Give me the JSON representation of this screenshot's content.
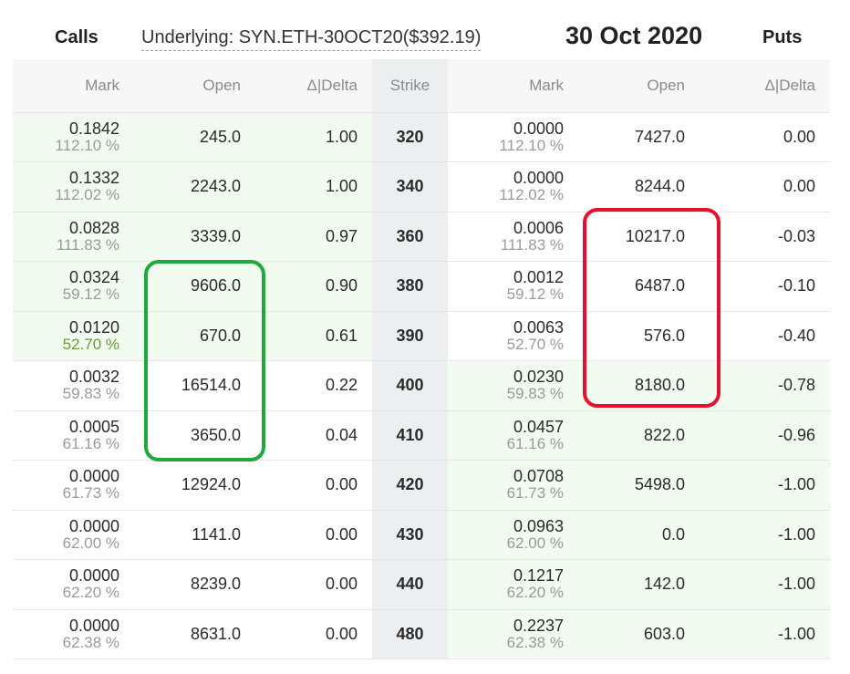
{
  "header": {
    "calls_label": "Calls",
    "underlying_label": "Underlying: SYN.ETH-30OCT20($392.19)",
    "date_label": "30 Oct 2020",
    "puts_label": "Puts"
  },
  "columns": {
    "call_mark": "Mark",
    "call_open": "Open",
    "call_delta": "Δ|Delta",
    "strike": "Strike",
    "put_mark": "Mark",
    "put_open": "Open",
    "put_delta": "Δ|Delta"
  },
  "colors": {
    "itm_background": "#f1fbf0",
    "green_highlight": "#1fa83b",
    "red_highlight": "#e4112f"
  },
  "rows": [
    {
      "call_mark": "0.1842",
      "call_iv": "112.10 %",
      "call_open": "245.0",
      "call_delta": "1.00",
      "strike": "320",
      "put_mark": "0.0000",
      "put_iv": "112.10 %",
      "put_open": "7427.0",
      "put_delta": "0.00",
      "call_itm": true,
      "put_itm": false
    },
    {
      "call_mark": "0.1332",
      "call_iv": "112.02 %",
      "call_open": "2243.0",
      "call_delta": "1.00",
      "strike": "340",
      "put_mark": "0.0000",
      "put_iv": "112.02 %",
      "put_open": "8244.0",
      "put_delta": "0.00",
      "call_itm": true,
      "put_itm": false
    },
    {
      "call_mark": "0.0828",
      "call_iv": "111.83 %",
      "call_open": "3339.0",
      "call_delta": "0.97",
      "strike": "360",
      "put_mark": "0.0006",
      "put_iv": "111.83 %",
      "put_open": "10217.0",
      "put_delta": "-0.03",
      "call_itm": true,
      "put_itm": false
    },
    {
      "call_mark": "0.0324",
      "call_iv": "59.12 %",
      "call_open": "9606.0",
      "call_delta": "0.90",
      "strike": "380",
      "put_mark": "0.0012",
      "put_iv": "59.12 %",
      "put_open": "6487.0",
      "put_delta": "-0.10",
      "call_itm": true,
      "put_itm": false
    },
    {
      "call_mark": "0.0120",
      "call_iv": "52.70 %",
      "call_open": "670.0",
      "call_delta": "0.61",
      "strike": "390",
      "put_mark": "0.0063",
      "put_iv": "52.70 %",
      "put_open": "576.0",
      "put_delta": "-0.40",
      "call_itm": true,
      "put_itm": false,
      "call_iv_green": true
    },
    {
      "call_mark": "0.0032",
      "call_iv": "59.83 %",
      "call_open": "16514.0",
      "call_delta": "0.22",
      "strike": "400",
      "put_mark": "0.0230",
      "put_iv": "59.83 %",
      "put_open": "8180.0",
      "put_delta": "-0.78",
      "call_itm": false,
      "put_itm": true
    },
    {
      "call_mark": "0.0005",
      "call_iv": "61.16 %",
      "call_open": "3650.0",
      "call_delta": "0.04",
      "strike": "410",
      "put_mark": "0.0457",
      "put_iv": "61.16 %",
      "put_open": "822.0",
      "put_delta": "-0.96",
      "call_itm": false,
      "put_itm": true
    },
    {
      "call_mark": "0.0000",
      "call_iv": "61.73 %",
      "call_open": "12924.0",
      "call_delta": "0.00",
      "strike": "420",
      "put_mark": "0.0708",
      "put_iv": "61.73 %",
      "put_open": "5498.0",
      "put_delta": "-1.00",
      "call_itm": false,
      "put_itm": true
    },
    {
      "call_mark": "0.0000",
      "call_iv": "62.00 %",
      "call_open": "1141.0",
      "call_delta": "0.00",
      "strike": "430",
      "put_mark": "0.0963",
      "put_iv": "62.00 %",
      "put_open": "0.0",
      "put_delta": "-1.00",
      "call_itm": false,
      "put_itm": true
    },
    {
      "call_mark": "0.0000",
      "call_iv": "62.20 %",
      "call_open": "8239.0",
      "call_delta": "0.00",
      "strike": "440",
      "put_mark": "0.1217",
      "put_iv": "62.20 %",
      "put_open": "142.0",
      "put_delta": "-1.00",
      "call_itm": false,
      "put_itm": true
    },
    {
      "call_mark": "0.0000",
      "call_iv": "62.38 %",
      "call_open": "8631.0",
      "call_delta": "0.00",
      "strike": "480",
      "put_mark": "0.2237",
      "put_iv": "62.38 %",
      "put_open": "603.0",
      "put_delta": "-1.00",
      "call_itm": false,
      "put_itm": true
    }
  ]
}
